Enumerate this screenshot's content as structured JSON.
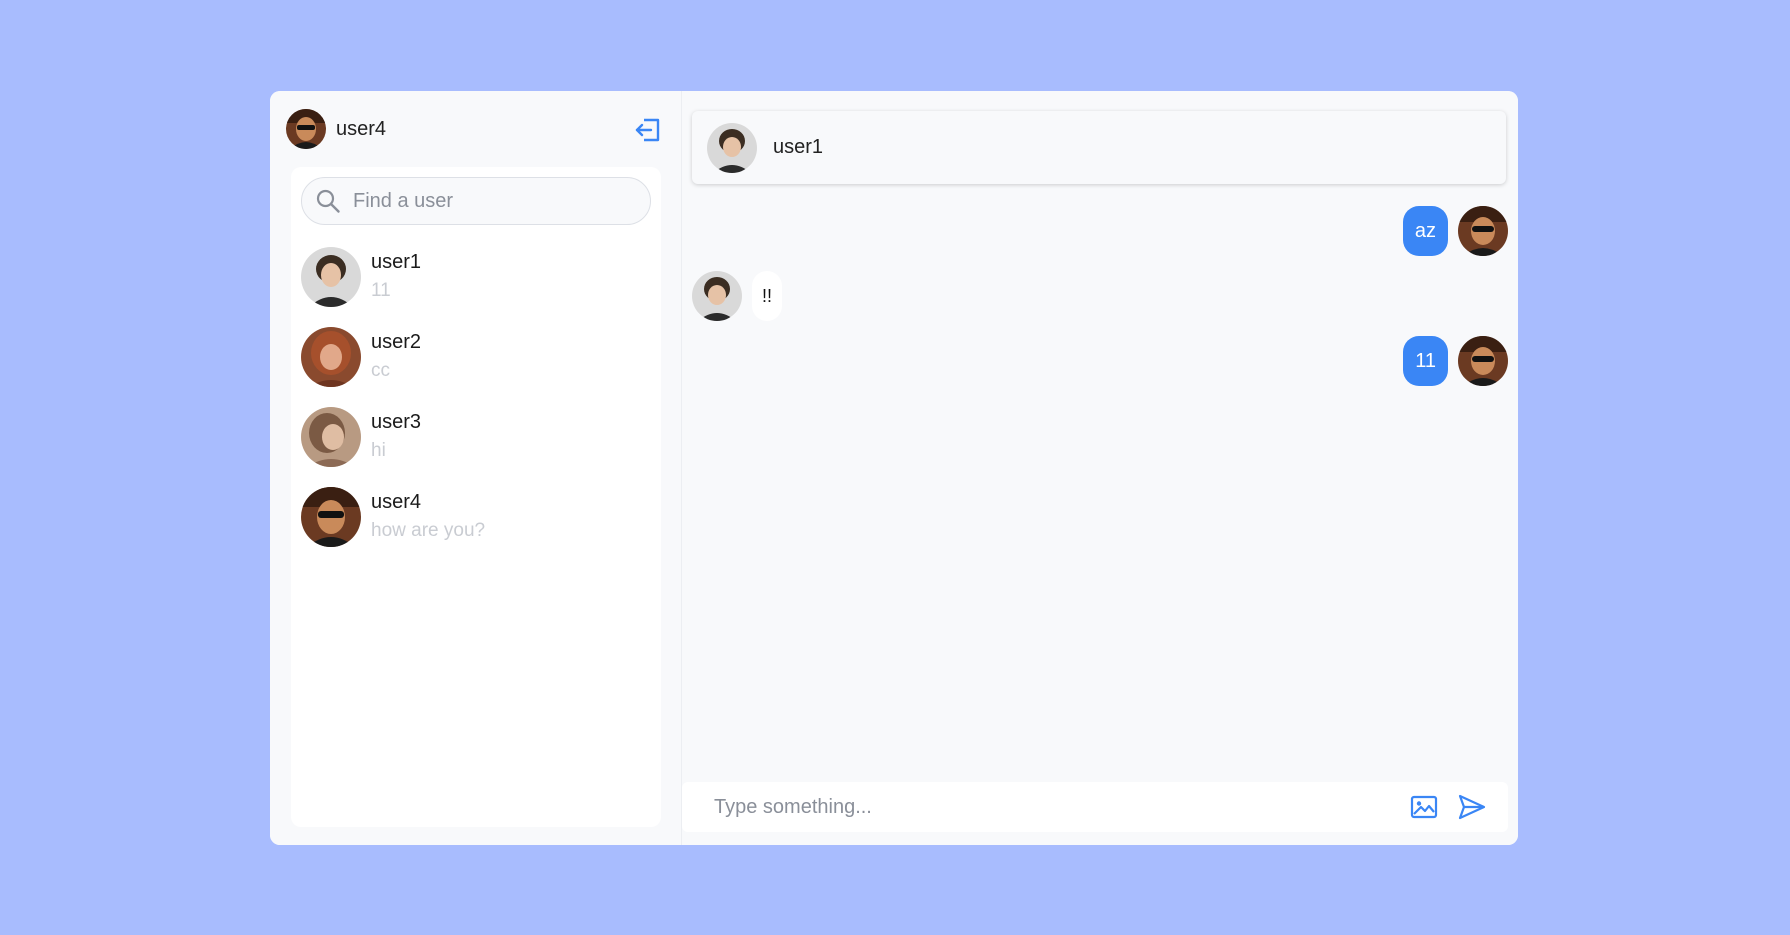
{
  "current_user": {
    "name": "user4"
  },
  "icons": {
    "logout": "logout-icon",
    "search": "search-icon",
    "image": "image-icon",
    "send": "send-icon"
  },
  "colors": {
    "background": "#a8bcfe",
    "accent": "#3a86f5",
    "panel": "#f8f9fb"
  },
  "search": {
    "placeholder": "Find a user",
    "value": ""
  },
  "users": [
    {
      "name": "user1",
      "last_message": "11"
    },
    {
      "name": "user2",
      "last_message": "cc"
    },
    {
      "name": "user3",
      "last_message": "hi"
    },
    {
      "name": "user4",
      "last_message": "how are you?"
    }
  ],
  "chat": {
    "partner_name": "user1",
    "messages": [
      {
        "sender": "me",
        "text": "az"
      },
      {
        "sender": "user1",
        "text": "!!"
      },
      {
        "sender": "me",
        "text": "11"
      }
    ]
  },
  "composer": {
    "placeholder": "Type something...",
    "value": ""
  }
}
